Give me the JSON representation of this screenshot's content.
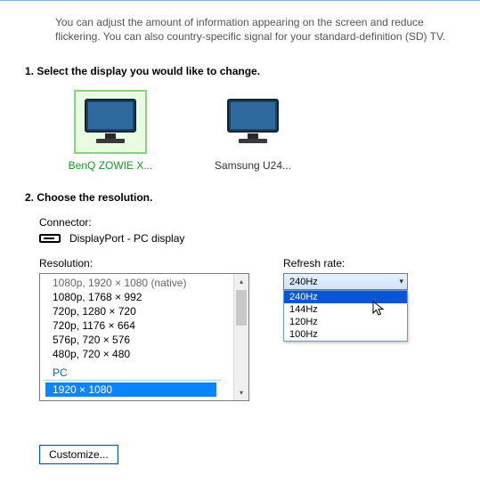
{
  "intro": "You can adjust the amount of information appearing on the screen and reduce flickering. You can also country-specific signal for your standard-definition (SD) TV.",
  "section1_heading": "1. Select the display you would like to change.",
  "displays": [
    {
      "label": "BenQ ZOWIE X...",
      "selected": true
    },
    {
      "label": "Samsung U24..."
    }
  ],
  "section2_heading": "2. Choose the resolution.",
  "connector_label": "Connector:",
  "connector_value": "DisplayPort - PC display",
  "resolution_label": "Resolution:",
  "resolution_items": [
    {
      "text": "1080p, 1920 × 1080 (native)",
      "faded": true
    },
    {
      "text": "1080p, 1768 × 992"
    },
    {
      "text": "720p, 1280 × 720"
    },
    {
      "text": "720p, 1176 × 664"
    },
    {
      "text": "576p, 720 × 576"
    },
    {
      "text": "480p, 720 × 480"
    }
  ],
  "resolution_group": "PC",
  "resolution_selected": "1920 × 1080",
  "refresh_label": "Refresh rate:",
  "refresh_selected": "240Hz",
  "refresh_options": [
    "240Hz",
    "144Hz",
    "120Hz",
    "100Hz"
  ],
  "customize_label": "Customize..."
}
